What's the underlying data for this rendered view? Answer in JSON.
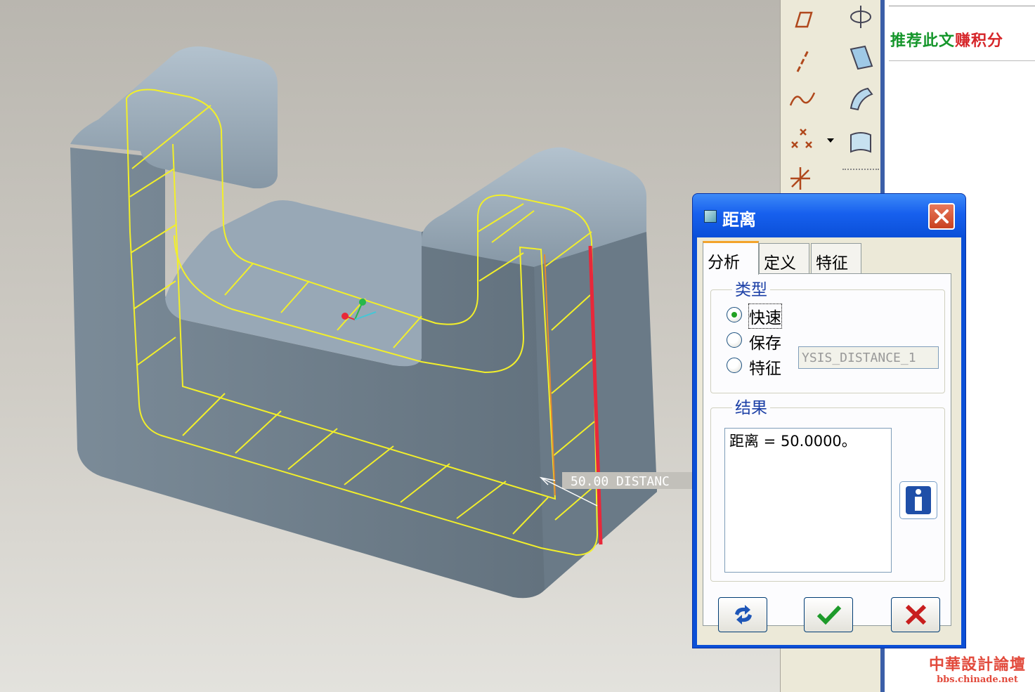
{
  "dialog": {
    "title": "距离",
    "tabs": [
      "分析",
      "定义",
      "特征"
    ],
    "active_tab": "分析",
    "type_group": {
      "label": "类型",
      "options": [
        {
          "label": "快速",
          "selected": true
        },
        {
          "label": "保存",
          "selected": false
        },
        {
          "label": "特征",
          "selected": false
        }
      ],
      "name_value": "YSIS_DISTANCE_1"
    },
    "result_group": {
      "label": "结果",
      "text": "距离 = 50.0000。"
    },
    "buttons": {
      "repeat_icon": "repeat-icon",
      "ok_icon": "check-icon",
      "cancel_icon": "x-icon"
    }
  },
  "viewport": {
    "annotation_text": "50.00  DISTANC",
    "colors": {
      "model": "#6e7e8c",
      "wire": "#f2ef2a",
      "measure_edge": "#e8283a",
      "reference_edge": "#e58a2f"
    }
  },
  "toolbar": {
    "icons": [
      "plane-icon",
      "point-on-axis-icon",
      "axis-icon",
      "surface-offset-icon",
      "curve-icon",
      "surface-merge-icon",
      "point-icon",
      "sketch-surface-icon",
      "coordinate-system-icon"
    ]
  },
  "web": {
    "text_green": "推荐此文",
    "text_red": "赚积分",
    "watermark_title": "中華設計論壇",
    "watermark_url": "bbs.chinade.net"
  }
}
